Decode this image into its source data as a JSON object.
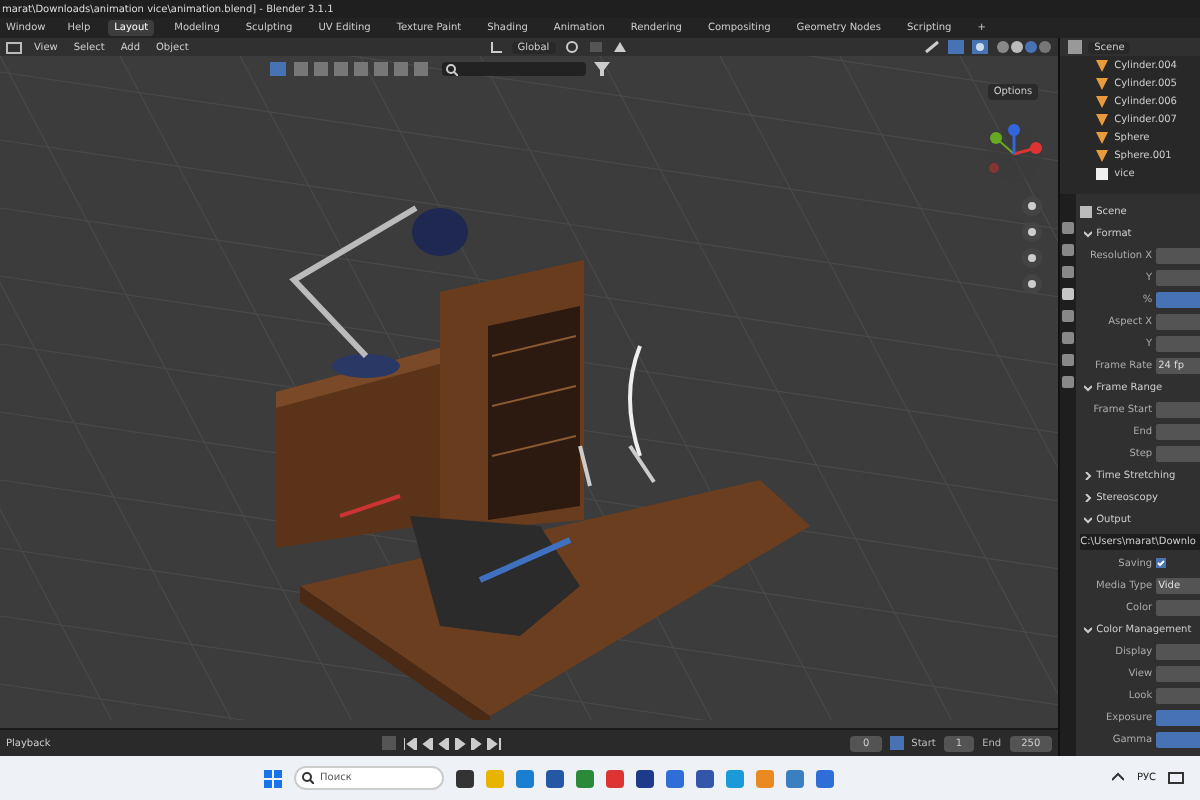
{
  "title_bar": {
    "title": "marat\\Downloads\\animation vice\\animation.blend] - Blender 3.1.1"
  },
  "menu": [
    "Window",
    "Help"
  ],
  "workspaces": [
    {
      "label": "Layout",
      "selected": true
    },
    {
      "label": "Modeling",
      "selected": false
    },
    {
      "label": "Sculpting",
      "selected": false
    },
    {
      "label": "UV Editing",
      "selected": false
    },
    {
      "label": "Texture Paint",
      "selected": false
    },
    {
      "label": "Shading",
      "selected": false
    },
    {
      "label": "Animation",
      "selected": false
    },
    {
      "label": "Rendering",
      "selected": false
    },
    {
      "label": "Compositing",
      "selected": false
    },
    {
      "label": "Geometry Nodes",
      "selected": false
    },
    {
      "label": "Scripting",
      "selected": false
    }
  ],
  "add_workspace": "+",
  "viewport": {
    "menu": [
      "View",
      "Select",
      "Add",
      "Object"
    ],
    "orientation": "Global",
    "options": "Options"
  },
  "outliner": {
    "scene": "Scene",
    "items": [
      {
        "label": "Cylinder.004",
        "kind": "object"
      },
      {
        "label": "Cylinder.005",
        "kind": "object"
      },
      {
        "label": "Cylinder.006",
        "kind": "object"
      },
      {
        "label": "Cylinder.007",
        "kind": "object"
      },
      {
        "label": "Sphere",
        "kind": "object"
      },
      {
        "label": "Sphere.001",
        "kind": "object"
      },
      {
        "label": "vice",
        "kind": "collection"
      }
    ]
  },
  "properties": {
    "scene": "Scene",
    "rows": [
      {
        "kind": "section",
        "label": "Format",
        "expanded": true
      },
      {
        "kind": "field",
        "label": "Resolution X",
        "active": false
      },
      {
        "kind": "field",
        "label": "Y",
        "active": false
      },
      {
        "kind": "field",
        "label": "%",
        "active": true
      },
      {
        "kind": "field",
        "label": "Aspect X",
        "active": false
      },
      {
        "kind": "field",
        "label": "Y",
        "active": false
      },
      {
        "kind": "field",
        "label": "Frame Rate",
        "value": "24 fp",
        "active": false
      },
      {
        "kind": "section",
        "label": "Frame Range",
        "expanded": true
      },
      {
        "kind": "field",
        "label": "Frame Start",
        "active": false
      },
      {
        "kind": "field",
        "label": "End",
        "active": false
      },
      {
        "kind": "field",
        "label": "Step",
        "active": false
      },
      {
        "kind": "section",
        "label": "Time Stretching",
        "expanded": false
      },
      {
        "kind": "section",
        "label": "Stereoscopy",
        "expanded": false
      },
      {
        "kind": "section",
        "label": "Output",
        "expanded": true
      },
      {
        "kind": "path",
        "value": "C:\\Users\\marat\\Downlo"
      },
      {
        "kind": "checkbox",
        "label": "Saving",
        "checked": true
      },
      {
        "kind": "field",
        "label": "Media Type",
        "value": "Vide",
        "active": false
      },
      {
        "kind": "field",
        "label": "Color",
        "active": false
      },
      {
        "kind": "section",
        "label": "Color Management",
        "expanded": true
      },
      {
        "kind": "field",
        "label": "Display",
        "active": false
      },
      {
        "kind": "field",
        "label": "View",
        "active": false
      },
      {
        "kind": "field",
        "label": "Look",
        "active": false
      },
      {
        "kind": "field",
        "label": "Exposure",
        "active": true
      },
      {
        "kind": "field",
        "label": "Gamma",
        "active": true
      }
    ]
  },
  "timeline": {
    "playback": "Playback",
    "frame": "0",
    "start_label": "Start",
    "start": "1",
    "end_label": "End",
    "end": "250"
  },
  "taskbar": {
    "search": {
      "placeholder": "Поиск"
    },
    "language": "РУС"
  }
}
